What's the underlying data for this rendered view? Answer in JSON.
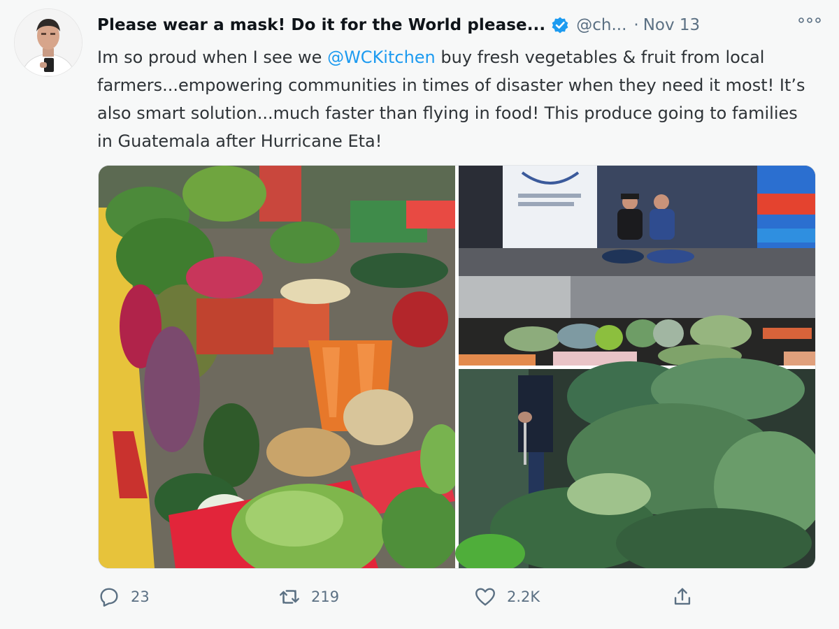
{
  "tweet": {
    "display_name": "Please wear a mask! Do it for the World please...",
    "handle": "@ch...",
    "separator": "·",
    "date": "Nov 13",
    "text_before_mention": "Im so proud when I see we ",
    "mention": "@WCKitchen",
    "text_after_mention": " buy fresh vegetables & fruit from local farmers...empowering communities in times of disaster when they need it most! It’s also smart solution...much faster than flying in food! This produce going to families in Guatemala after Hurricane Eta!",
    "verified": true
  },
  "icons": {
    "more": "more-horizontal-icon",
    "verified": "verified-badge-icon",
    "reply": "reply-icon",
    "retweet": "retweet-icon",
    "like": "heart-icon",
    "share": "share-icon"
  },
  "actions": {
    "reply_count": "23",
    "retweet_count": "219",
    "like_count": "2.2K"
  },
  "colors": {
    "accent": "#1d9bf0",
    "muted": "#5b7083",
    "text": "#0f1419"
  }
}
